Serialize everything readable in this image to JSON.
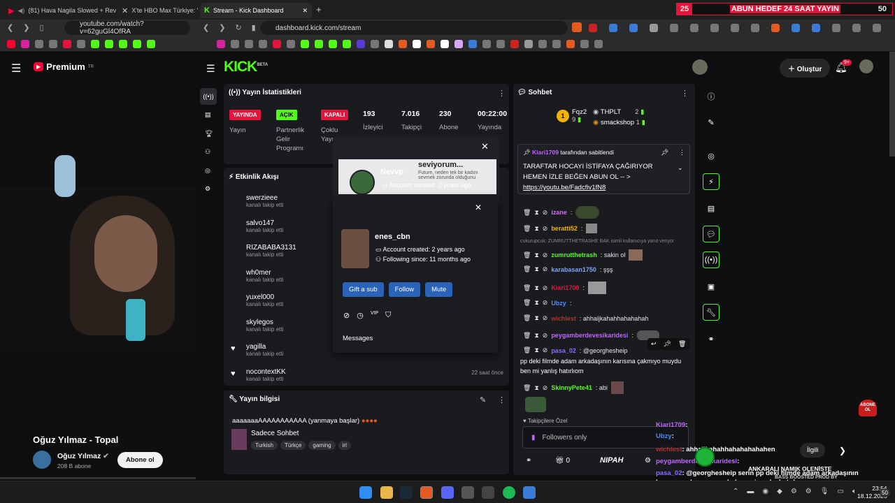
{
  "tabs": [
    {
      "label": "(81) Hava Nagila Slowed + Reve",
      "icon": "youtube-icon",
      "active": false
    },
    {
      "label": "X'te HBO Max Türkiye: \"Tc",
      "icon": "x-icon",
      "active": false
    },
    {
      "label": "Stream - Kick Dashboard",
      "icon": "kick-icon",
      "active": true
    }
  ],
  "address_left": "youtube.com/watch?v=62guGl4OfRA",
  "address_right": "dashboard.kick.com/stream",
  "overlay_top": {
    "left": "25",
    "center": "ABUN HEDEF 24 SAAT YAYIN",
    "right": "50"
  },
  "youtube": {
    "logo": "Premium",
    "logo_sup": "TR",
    "create": "Oluştur",
    "notif": "9+",
    "video_title": "Oğuz Yılmaz - Topal",
    "channel": "Oğuz Yılmaz",
    "subs": "208 B abone",
    "subscribe": "Abone ol",
    "share": "İlgili"
  },
  "kick": {
    "logo": "KICK",
    "logo_sup": "BETA",
    "stats_title": "Yayın İstatistikleri",
    "status_badges": [
      {
        "badge": "YAYINDA",
        "label": "Yayın",
        "color": "#e5143c"
      },
      {
        "badge": "AÇIK",
        "label": "Partnerlik Gelir Programı",
        "color": "#53fc18"
      },
      {
        "badge": "KAPALI",
        "label": "Çoklu Yayın",
        "color": "#e5143c"
      }
    ],
    "stats": [
      {
        "value": "193",
        "label": "İzleyici"
      },
      {
        "value": "7.016",
        "label": "Takipçi"
      },
      {
        "value": "230",
        "label": "Abone"
      },
      {
        "value": "00:22:00",
        "label": "Yayında"
      }
    ],
    "activity_title": "Etkinlik Akışı",
    "activity": [
      {
        "name": "swerzieee",
        "sub": "kanalı takip etti",
        "time": ""
      },
      {
        "name": "salvo147",
        "sub": "kanalı takip etti",
        "time": ""
      },
      {
        "name": "RIZABABA3131",
        "sub": "kanalı takip etti",
        "time": ""
      },
      {
        "name": "wh0mer",
        "sub": "kanalı takip etti",
        "time": ""
      },
      {
        "name": "yuxel000",
        "sub": "kanalı takip etti",
        "time": ""
      },
      {
        "name": "skylegos",
        "sub": "kanalı takip etti",
        "time": ""
      },
      {
        "name": "yagilla",
        "sub": "kanalı takip etti",
        "time": ""
      },
      {
        "name": "nocontextKK",
        "sub": "kanalı takip etti",
        "time": "22 saat önce"
      }
    ],
    "info_title": "Yayın bilgisi",
    "stream_title": "aaaaaaaAAAAAAAAAAA (yanmaya başlar)",
    "category": "Sadece Sohbet",
    "tags": [
      "Turkish",
      "Türkçe",
      "gaming",
      "irl"
    ],
    "chat_title": "Sohbet",
    "leaders": [
      {
        "name": "Fqz2",
        "count": "9"
      },
      {
        "name": "THPLT",
        "count": "2"
      },
      {
        "name": "smackshop",
        "count": "1"
      }
    ],
    "pinned": {
      "by": "Kiari1709",
      "suffix": "tarafından sabitlendi",
      "text": "TARAFTAR HOCAYI İSTİFAYA ÇAĞIRIYOR HEMEN İZLE BEĞEN ABUN OL -- >",
      "link": "https://youtu.be/Fadcfiv1fN8"
    },
    "reply_note": "cukurupcuk: ZUMRUTTHETRASHE BAK isimli kullanıcıya yanıt veriyor",
    "messages": [
      {
        "name": "izane",
        "text": ":",
        "color": "#d36cff"
      },
      {
        "name": "beratti52",
        "text": ":",
        "color": "#f0b400"
      },
      {
        "name": "zumrutthetrash",
        "text": ": sakin ol",
        "color": "#53fc18"
      },
      {
        "name": "karabasan1750",
        "text": ": şşş",
        "color": "#7aa4ff"
      },
      {
        "name": "Kiari1709",
        "text": ":",
        "color": "#e5143c"
      },
      {
        "name": "Ubzy",
        "text": ":",
        "color": "#4c8bff"
      },
      {
        "name": "wichlest",
        "text": ": ahhaljkahahhahahahah",
        "color": "#a33"
      },
      {
        "name": "peygamberdevesikaridesi",
        "text": ":",
        "color": "#c263ff"
      },
      {
        "name": "pasa_02",
        "text": ": @georghesheip",
        "color": "#8a6bff"
      },
      {
        "name": "SkinnyPete41",
        "text": ": abi",
        "color": "#53fc18"
      }
    ],
    "msg_continuation": "pp deki filmde adam arkadaşının karısına çakmıyo muydu ben mi yanlış hatırlıom",
    "followers_note": "Takipçilere Özel",
    "followers_only": "Followers only",
    "footer_count": "0",
    "footer_logo": "NIPAH"
  },
  "popup1": {
    "name": "Nevvp",
    "account": "Account created: 2 years ago",
    "banner_text": "seviyorum...",
    "banner_sub": "Future, neden tek bir kadını sevmek zorunda olduğunu"
  },
  "popup2": {
    "name": "enes_cbn",
    "account": "Account created: 2 years ago",
    "following": "Following since: 11 months ago",
    "buttons": [
      "Gift a sub",
      "Follow",
      "Mute"
    ],
    "messages": "Messages"
  },
  "overlay_chat": [
    {
      "name": "Kiari1709",
      "text": ":"
    },
    {
      "name": "Ubzy",
      "text": ":"
    },
    {
      "name": "wichlest",
      "text": ": ahhaljkahahhahahahahahen"
    },
    {
      "name": "peygamberdevesikaridesi",
      "text": ":"
    },
    {
      "name": "pasa_02",
      "text": ": @georghesheip"
    }
  ],
  "overlay_banner": "ANKARALI NAMIK OLENİSTE",
  "overlay_banner2": "BASS BOOSTED PROD BY",
  "overlay_msg2": "serin pp deki filmde adam arkadaşının",
  "overlay_msg3": "karısına çakmıyo muydu ben mi yanlış hatırlıom",
  "abone_badge": "ABONE OL",
  "clock": {
    "time": "23:54",
    "date": "18.12.2025"
  },
  "notif_count": "50"
}
